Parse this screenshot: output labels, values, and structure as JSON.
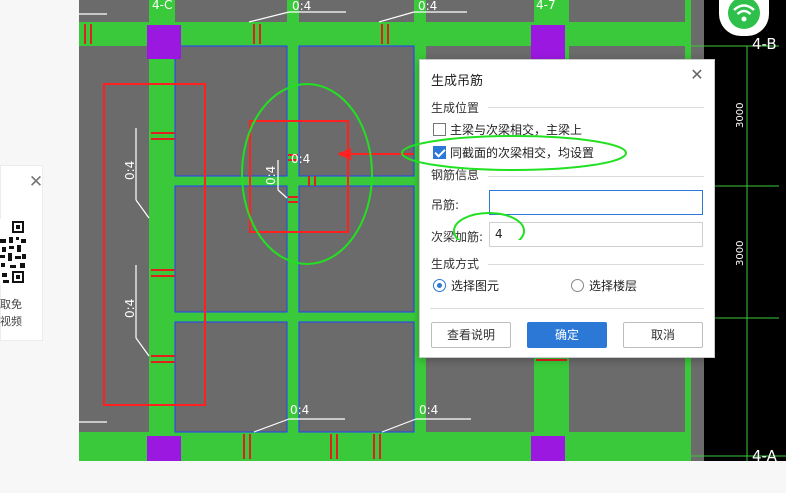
{
  "side_panel": {
    "close_icon": "close-icon",
    "qr_icon": "qr-code-icon",
    "text_line1": "取免",
    "text_line2": "视频"
  },
  "canvas": {
    "grid_labels": {
      "top_left": "4-C",
      "top_right": "4-7",
      "right_top": "4-B",
      "right_bottom": "4-A"
    },
    "dims": [
      "3000",
      "3000"
    ],
    "beam_labels": [
      "0:4",
      "0:4",
      "0:4",
      "0:4",
      "0:4",
      "0:4",
      "0:4",
      "0:4"
    ],
    "colors": {
      "beam": "#3ac93a",
      "slab": "#6b6b6b",
      "column": "#9b18e0",
      "annotation": "#ff2020",
      "ellipse": "#22e022"
    }
  },
  "dialog": {
    "title": "生成吊筋",
    "close_icon": "close-icon",
    "position_section": "生成位置",
    "option1_label": "主梁与次梁相交，主梁上",
    "option1_checked": false,
    "option2_label": "同截面的次梁相交，均设置",
    "option2_checked": true,
    "rebar_section": "钢筋信息",
    "hanger_label": "吊筋:",
    "hanger_value": "",
    "secondary_label": "次梁加筋:",
    "secondary_value": "4",
    "method_section": "生成方式",
    "radio1_label": "选择图元",
    "radio1_checked": true,
    "radio2_label": "选择楼层",
    "radio2_checked": false,
    "btn_help": "查看说明",
    "btn_ok": "确定",
    "btn_cancel": "取消"
  },
  "wifi_icon": "wifi-icon"
}
